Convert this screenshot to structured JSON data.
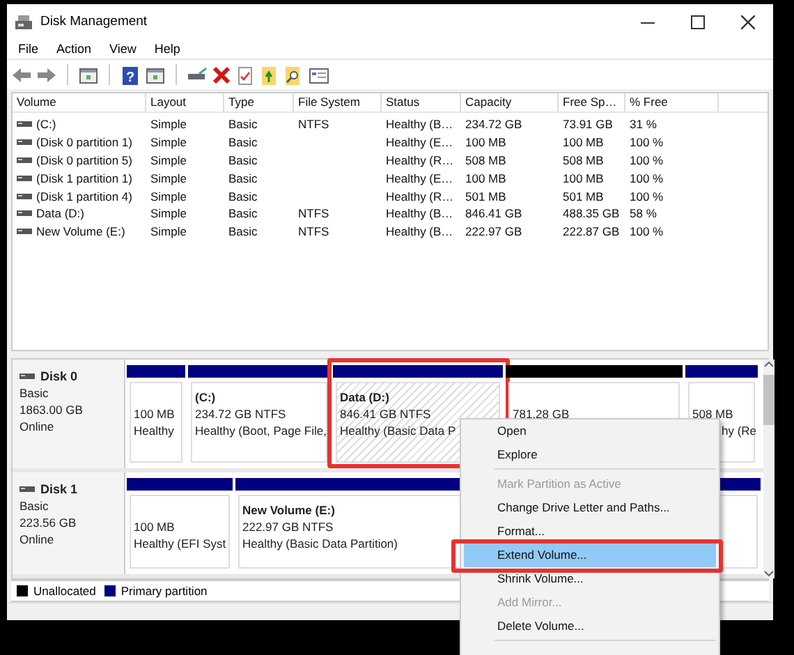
{
  "window": {
    "title": "Disk Management"
  },
  "menu": [
    "File",
    "Action",
    "View",
    "Help"
  ],
  "toolbar": [
    {
      "kind": "back"
    },
    {
      "kind": "forward"
    },
    {
      "kind": "separator"
    },
    {
      "kind": "panel"
    },
    {
      "kind": "separator"
    },
    {
      "kind": "help",
      "glyph": "?"
    },
    {
      "kind": "panel"
    },
    {
      "kind": "separator"
    },
    {
      "kind": "drive"
    },
    {
      "kind": "delete"
    },
    {
      "kind": "document"
    },
    {
      "kind": "folder"
    },
    {
      "kind": "folder-search"
    },
    {
      "kind": "window"
    }
  ],
  "volume_list": {
    "columns": [
      "Volume",
      "Layout",
      "Type",
      "File System",
      "Status",
      "Capacity",
      "Free Sp…",
      "% Free"
    ],
    "rows": [
      [
        "(C:)",
        "Simple",
        "Basic",
        "NTFS",
        "Healthy (B…",
        "234.72 GB",
        "73.91 GB",
        "31 %"
      ],
      [
        "(Disk 0 partition 1)",
        "Simple",
        "Basic",
        "",
        "Healthy (E…",
        "100 MB",
        "100 MB",
        "100 %"
      ],
      [
        "(Disk 0 partition 5)",
        "Simple",
        "Basic",
        "",
        "Healthy (R…",
        "508 MB",
        "508 MB",
        "100 %"
      ],
      [
        "(Disk 1 partition 1)",
        "Simple",
        "Basic",
        "",
        "Healthy (E…",
        "100 MB",
        "100 MB",
        "100 %"
      ],
      [
        "(Disk 1 partition 4)",
        "Simple",
        "Basic",
        "",
        "Healthy (R…",
        "501 MB",
        "501 MB",
        "100 %"
      ],
      [
        "Data (D:)",
        "Simple",
        "Basic",
        "NTFS",
        "Healthy (B…",
        "846.41 GB",
        "488.35 GB",
        "58 %"
      ],
      [
        "New Volume (E:)",
        "Simple",
        "Basic",
        "NTFS",
        "Healthy (B…",
        "222.97 GB",
        "222.87 GB",
        "100 %"
      ]
    ]
  },
  "disks": [
    {
      "name": "Disk 0",
      "type": "Basic",
      "size": "1863.00 GB",
      "status": "Online",
      "partitions": [
        {
          "kind": "primary",
          "size": "100 MB",
          "status": "Healthy",
          "selected": false,
          "highlighted": false
        },
        {
          "kind": "primary",
          "title": "(C:)",
          "size": "234.72 GB NTFS",
          "status": "Healthy (Boot, Page File,",
          "selected": false,
          "highlighted": false
        },
        {
          "kind": "primary",
          "title": "Data  (D:)",
          "size": "846.41 GB NTFS",
          "status": "Healthy (Basic Data P",
          "selected": true,
          "highlighted": true
        },
        {
          "kind": "unallocated",
          "size": "781.28 GB",
          "selected": false,
          "highlighted": false
        },
        {
          "kind": "primary",
          "size": "508 MB",
          "status": "hy (Re",
          "selected": false,
          "highlighted": false
        }
      ]
    },
    {
      "name": "Disk 1",
      "type": "Basic",
      "size": "223.56 GB",
      "status": "Online",
      "partitions": [
        {
          "kind": "primary",
          "size": "100 MB",
          "status": "Healthy (EFI Syst",
          "selected": false,
          "highlighted": false
        },
        {
          "kind": "primary",
          "title": "New Volume  (E:)",
          "size": "222.97 GB NTFS",
          "status": "Healthy (Basic Data Partition)",
          "selected": false,
          "highlighted": false
        }
      ]
    }
  ],
  "legend": [
    {
      "label": "Unallocated",
      "color": "#000000"
    },
    {
      "label": "Primary partition",
      "color": "#000080"
    }
  ],
  "context_menu": {
    "items": [
      {
        "kind": "item",
        "label": "Open",
        "disabled": false,
        "selected": false,
        "highlighted": false
      },
      {
        "kind": "item",
        "label": "Explore",
        "disabled": false,
        "selected": false,
        "highlighted": false
      },
      {
        "kind": "separator"
      },
      {
        "kind": "item",
        "label": "Mark Partition as Active",
        "disabled": true,
        "selected": false,
        "highlighted": false
      },
      {
        "kind": "item",
        "label": "Change Drive Letter and Paths...",
        "disabled": false,
        "selected": false,
        "highlighted": false
      },
      {
        "kind": "item",
        "label": "Format...",
        "disabled": false,
        "selected": false,
        "highlighted": false
      },
      {
        "kind": "item",
        "label": "Extend Volume...",
        "disabled": false,
        "selected": true,
        "highlighted": true
      },
      {
        "kind": "item",
        "label": "Shrink Volume...",
        "disabled": false,
        "selected": false,
        "highlighted": false
      },
      {
        "kind": "item",
        "label": "Add Mirror...",
        "disabled": true,
        "selected": false,
        "highlighted": false
      },
      {
        "kind": "item",
        "label": "Delete Volume...",
        "disabled": false,
        "selected": false,
        "highlighted": false
      },
      {
        "kind": "separator"
      }
    ]
  }
}
